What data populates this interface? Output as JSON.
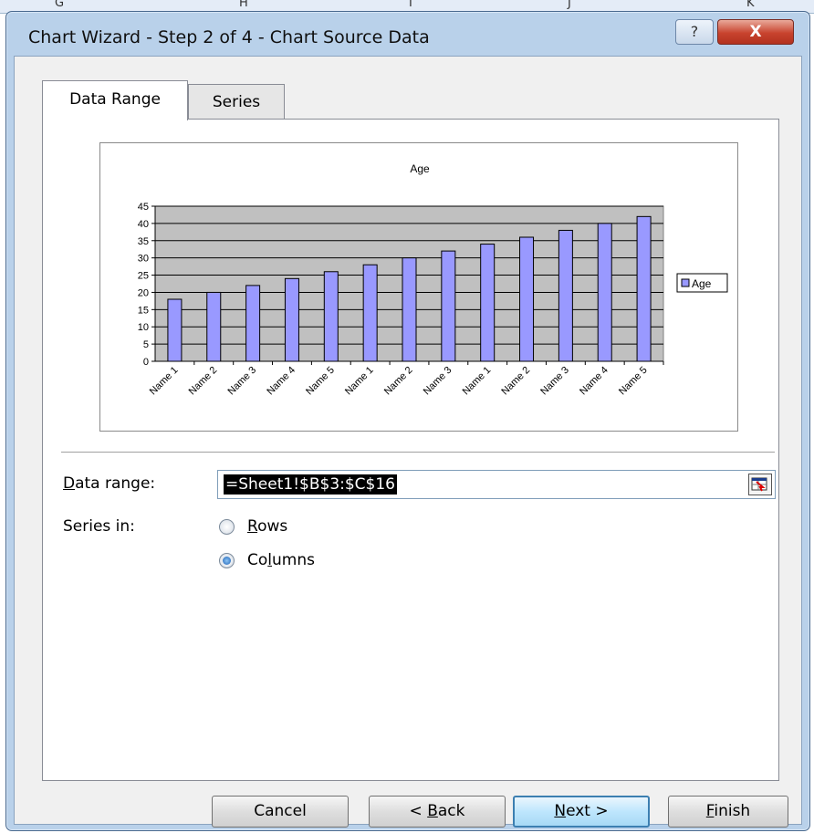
{
  "background": {
    "column_letters": [
      "G",
      "H",
      "I",
      "J",
      "K"
    ]
  },
  "dialog": {
    "title": "Chart Wizard - Step 2 of 4 - Chart Source Data",
    "help_label": "?",
    "close_label": "X"
  },
  "tabs": [
    {
      "label": "Data Range",
      "active": true
    },
    {
      "label": "Series",
      "active": false
    }
  ],
  "chart_data": {
    "type": "bar",
    "title": "Age",
    "categories": [
      "Name 1",
      "Name 2",
      "Name 3",
      "Name 4",
      "Name 5",
      "Name 1",
      "Name 2",
      "Name 3",
      "Name 1",
      "Name 2",
      "Name 3",
      "Name 4",
      "Name 5"
    ],
    "series": [
      {
        "name": "Age",
        "values": [
          18,
          20,
          22,
          24,
          26,
          28,
          30,
          32,
          34,
          36,
          38,
          40,
          42
        ],
        "color": "#9999ff"
      }
    ],
    "ylim": [
      0,
      45
    ],
    "yticks": [
      "0",
      "5",
      "10",
      "15",
      "20",
      "25",
      "30",
      "35",
      "40",
      "45"
    ],
    "plot_background": "#c0c0c0",
    "grid": true,
    "legend_position": "right"
  },
  "form": {
    "data_range_label": "ata range:",
    "data_range_label_key": "D",
    "data_range_value": "=Sheet1!$B$3:$C$16",
    "series_in_label": "Series in:",
    "rows_label_key": "R",
    "rows_label": "ows",
    "columns_label_pre": "Co",
    "columns_label_key": "l",
    "columns_label_post": "umns",
    "series_in_selected": "Columns"
  },
  "buttons": {
    "cancel": "Cancel",
    "back_pre": "< ",
    "back_key": "B",
    "back_post": "ack",
    "next_key": "N",
    "next_post": "ext >",
    "finish_key": "F",
    "finish_post": "inish"
  }
}
